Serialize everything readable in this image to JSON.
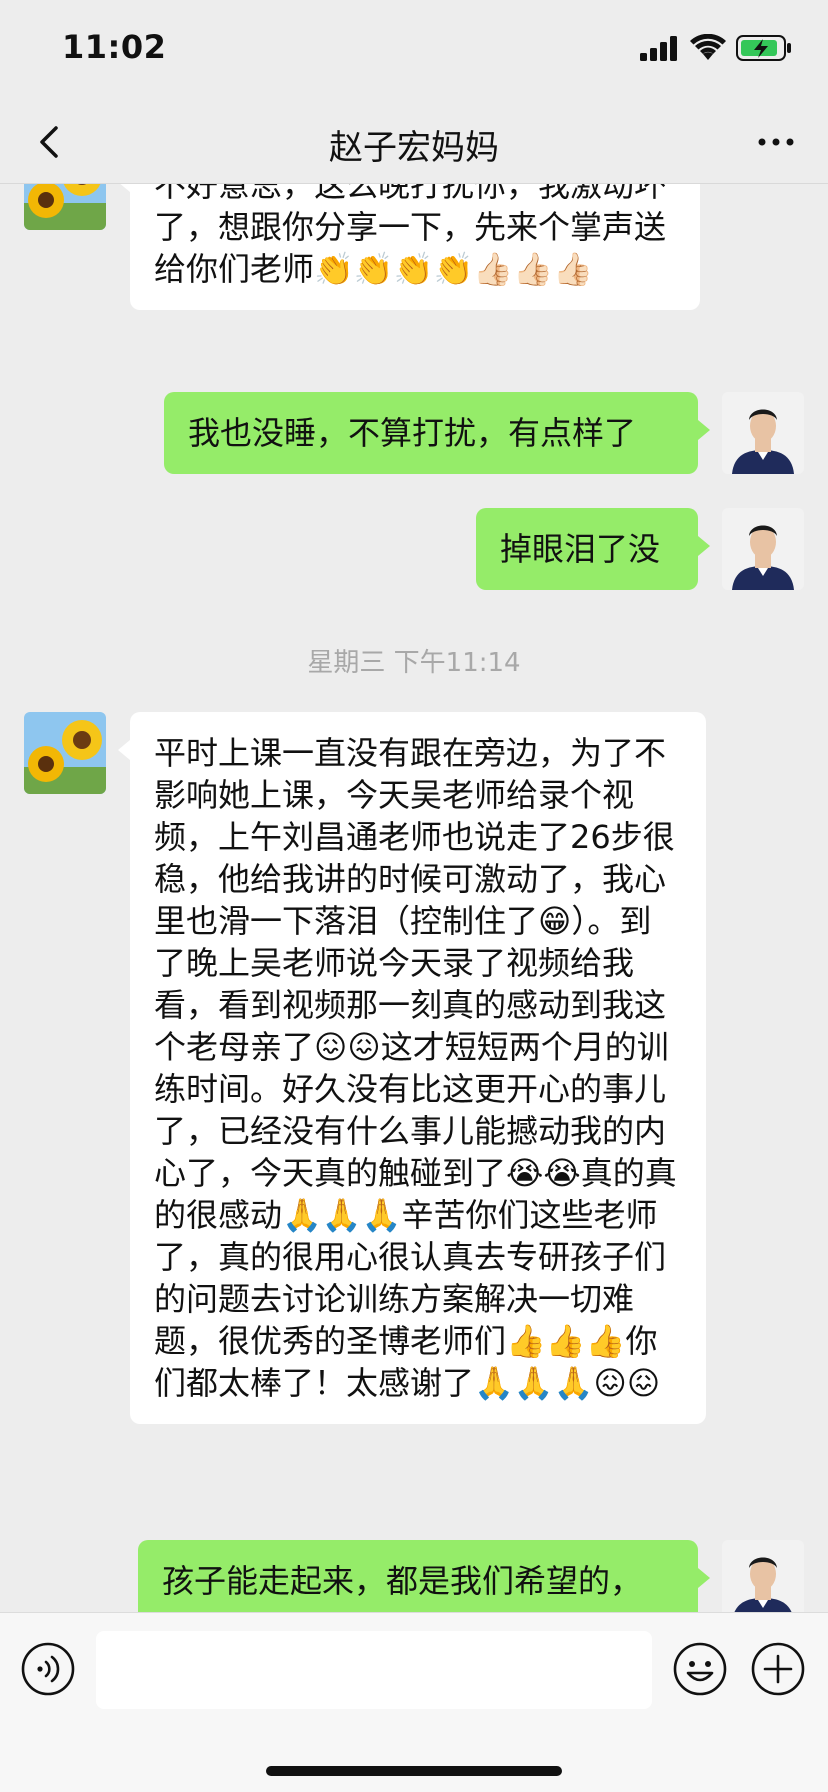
{
  "status": {
    "time": "11:02"
  },
  "nav": {
    "title": "赵子宏妈妈"
  },
  "messages": [
    {
      "side": "in",
      "text": "不好意思，这么晚打扰你，我激动坏了，想跟你分享一下，先来个掌声送给你们老师👏👏👏👏👍🏻👍🏻👍🏻"
    },
    {
      "side": "out",
      "text": "我也没睡，不算打扰，有点样了"
    },
    {
      "side": "out",
      "text": "掉眼泪了没"
    },
    {
      "side": "in",
      "text": "平时上课一直没有跟在旁边，为了不影响她上课，今天吴老师给录个视频，上午刘昌通老师也说走了26步很稳，他给我讲的时候可激动了，我心里也滑一下落泪（控制住了😁）。到了晚上吴老师说今天录了视频给我看，看到视频那一刻真的感动到我这个老母亲了😖😖这才短短两个月的训练时间。好久没有比这更开心的事儿了，已经没有什么事儿能撼动我的内心了，今天真的触碰到了😭😭真的真的很感动🙏🙏🙏辛苦你们这些老师了，真的很用心很认真去专研孩子们的问题去讨论训练方案解决一切难题，很优秀的圣博老师们👍👍👍你们都太棒了！太感谢了🙏🙏🙏😖😖"
    },
    {
      "side": "out",
      "text": "孩子能走起来，都是我们希望的，"
    }
  ],
  "timestamp": "星期三 下午11:14",
  "input": {
    "placeholder": ""
  },
  "icons": {
    "back": "chevron-left-icon",
    "more": "more-horizontal-icon",
    "voice": "voice-icon",
    "emoji": "emoji-icon",
    "plus": "plus-icon"
  },
  "colors": {
    "incoming_bubble": "#ffffff",
    "outgoing_bubble": "#95ec69",
    "background": "#ededed"
  }
}
